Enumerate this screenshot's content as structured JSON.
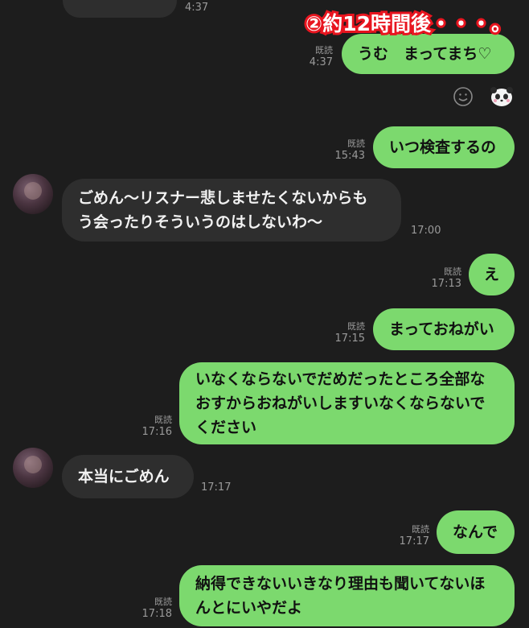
{
  "caption": "②約12時間後・・・。",
  "messages": [
    {
      "text": "うむ　まってまち♡",
      "read": "既読",
      "time": "4:37"
    },
    {
      "text": "いつ検査するの",
      "read": "既読",
      "time": "15:43"
    },
    {
      "text": "ごめん〜リスナー悲しませたくないからもう会ったりそういうのはしないわ〜",
      "line1": "ごめん〜リスナー悲しませたくないからも",
      "line2": "う会ったりそういうのはしないわ〜",
      "time": "17:00"
    },
    {
      "text": "え",
      "read": "既読",
      "time": "17:13"
    },
    {
      "text": "まっておねがい",
      "read": "既読",
      "time": "17:15"
    },
    {
      "line1": "いなくならないでだめだったところ全部な",
      "line2": "おすからおねがいしますいなくならないで",
      "line3": "ください",
      "read": "既読",
      "time": "17:16"
    },
    {
      "text": "本当にごめん",
      "time": "17:17"
    },
    {
      "text": "なんで",
      "read": "既読",
      "time": "17:17"
    },
    {
      "line1": "納得できないいきなり理由も聞いてないほ",
      "line2": "んとにいやだよ",
      "read": "既読",
      "time": "17:18"
    }
  ],
  "top_partial_time": "4:37",
  "icons": {
    "emoji": "smiley-icon",
    "sticker": "panda-sticker-icon"
  },
  "colors": {
    "background": "#1d1d1d",
    "outgoing_bubble": "#7cd96e",
    "incoming_bubble": "#2e2e2e",
    "caption_stroke": "#e8151f"
  }
}
